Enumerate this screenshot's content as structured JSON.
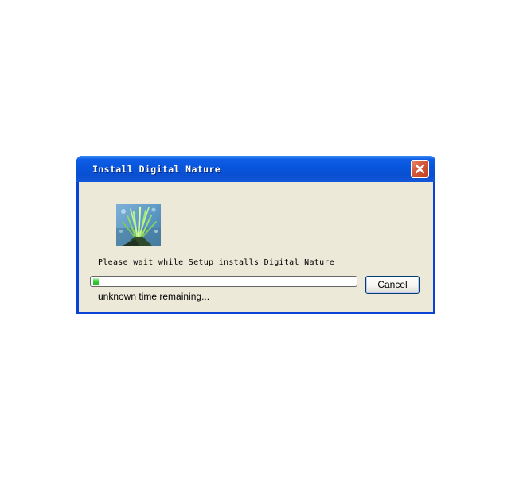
{
  "window": {
    "title": "Install Digital Nature"
  },
  "title_buttons": {
    "close_icon": "close-icon"
  },
  "content": {
    "app_icon": "digital-nature-grass-image",
    "status": "Please wait while Setup installs Digital Nature",
    "progress_fraction": 0.02,
    "time_remaining": "unknown time remaining...",
    "cancel_label": "Cancel"
  },
  "colors": {
    "titlebar": "#0855dd",
    "client_bg": "#ece9d8",
    "close_button": "#d55a3b",
    "progress_fill": "#37d637"
  }
}
